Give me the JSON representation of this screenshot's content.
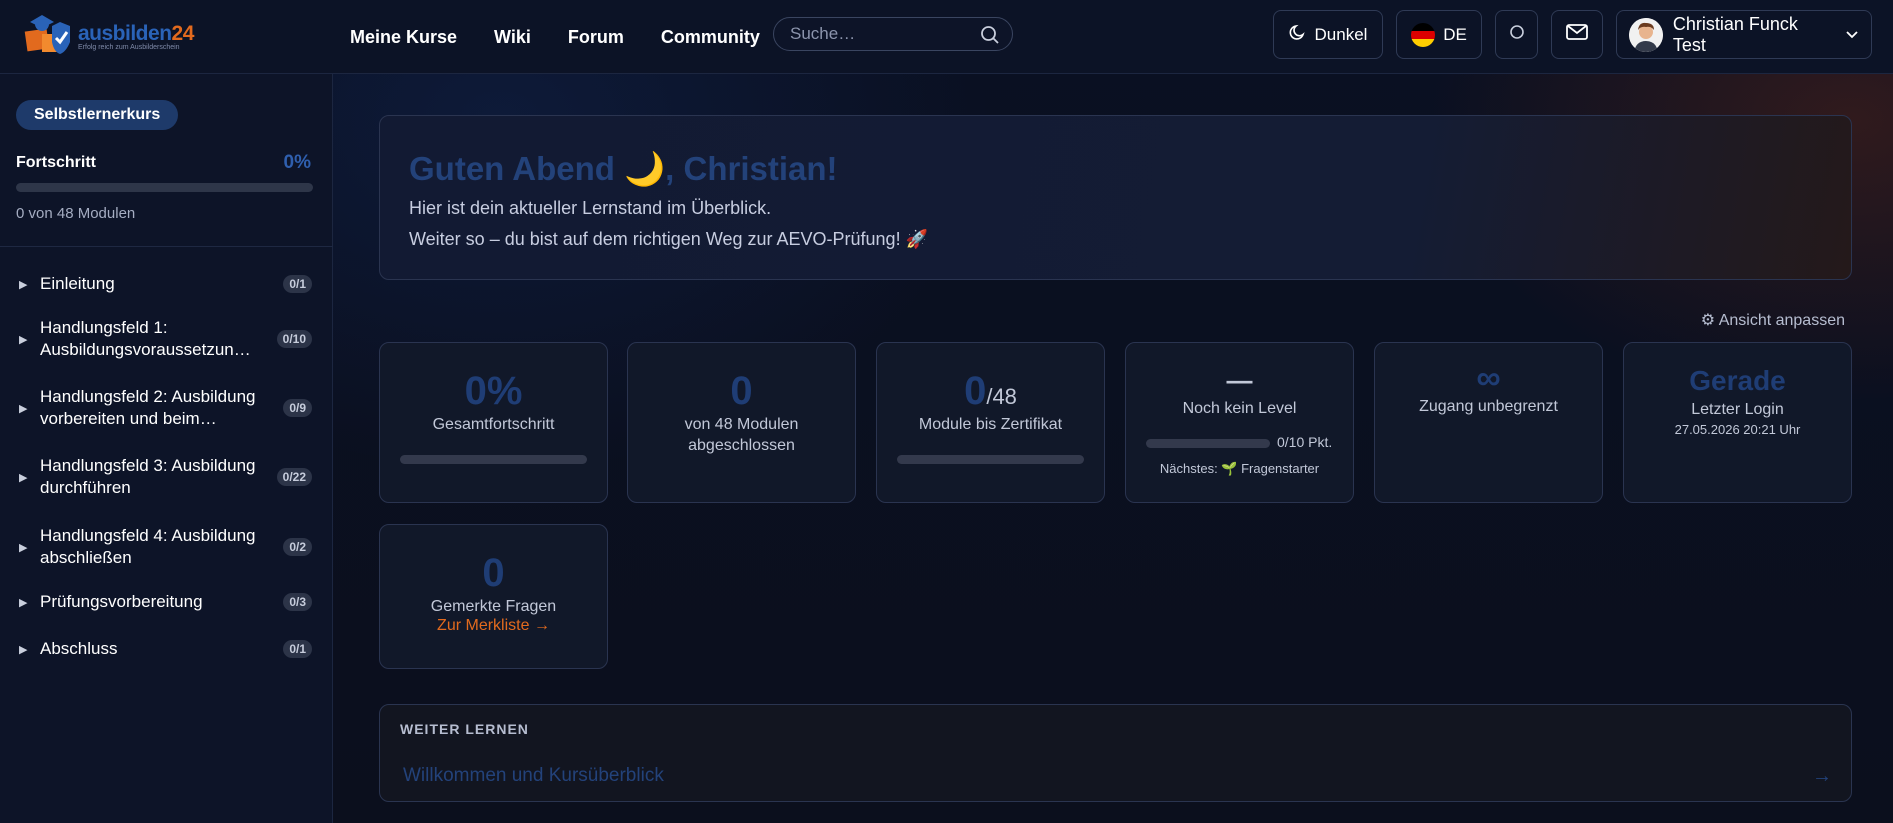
{
  "header": {
    "logo": {
      "brand_left": "ausbilden",
      "brand_right": "24",
      "tagline": "Erfolg reich zum Ausbilderschein"
    },
    "nav": [
      "Meine Kurse",
      "Wiki",
      "Forum",
      "Community"
    ],
    "search_placeholder": "Suche…",
    "theme_label": "Dunkel",
    "language_label": "DE",
    "user_name": "Christian Funck Test"
  },
  "sidebar": {
    "course_type": "Selbstlernerkurs",
    "progress_label": "Fortschritt",
    "progress_pct": "0%",
    "progress_value": 0,
    "modules_text": "0 von 48 Modulen",
    "items": [
      {
        "label": "Einleitung",
        "badge": "0/1"
      },
      {
        "label": "Handlungsfeld 1: Ausbildungsvoraussetzun…",
        "badge": "0/10"
      },
      {
        "label": "Handlungsfeld 2: Ausbildung vorbereiten und beim…",
        "badge": "0/9"
      },
      {
        "label": "Handlungsfeld 3: Ausbildung durchführen",
        "badge": "0/22"
      },
      {
        "label": "Handlungsfeld 4: Ausbildung abschließen",
        "badge": "0/2"
      },
      {
        "label": "Prüfungsvorbereitung",
        "badge": "0/3"
      },
      {
        "label": "Abschluss",
        "badge": "0/1"
      }
    ]
  },
  "hero": {
    "greeting": "Guten Abend 🌙, Christian!",
    "line1": "Hier ist dein aktueller Lernstand im Überblick.",
    "line2": "Weiter so – du bist auf dem richtigen Weg zur AEVO-Prüfung! 🚀"
  },
  "customize_label": "⚙ Ansicht anpassen",
  "cards": {
    "progress": {
      "value": "0%",
      "label": "Gesamtfortschritt",
      "fill": 0
    },
    "completed": {
      "value": "0",
      "label": "von 48 Modulen abgeschlossen"
    },
    "certificate": {
      "value": "0",
      "suffix": "/48",
      "label": "Module bis Zertifikat",
      "fill": 0
    },
    "level": {
      "value": "—",
      "label": "Noch kein Level",
      "points": "0/10 Pkt.",
      "fill": 0,
      "next": "Nächstes: 🌱 Fragenstarter"
    },
    "access": {
      "value": "∞",
      "label": "Zugang unbegrenzt"
    },
    "login": {
      "value": "Gerade",
      "label": "Letzter Login",
      "date": "27.05.2026 20:21 Uhr"
    },
    "bookmarks": {
      "value": "0",
      "label": "Gemerkte Fragen",
      "link": "Zur Merkliste →"
    }
  },
  "continue": {
    "heading": "WEITER LERNEN",
    "title": "Willkommen und Kursüberblick",
    "arrow": "→"
  },
  "colors": {
    "accent": "#2f5fae",
    "orange": "#e26a1e"
  }
}
